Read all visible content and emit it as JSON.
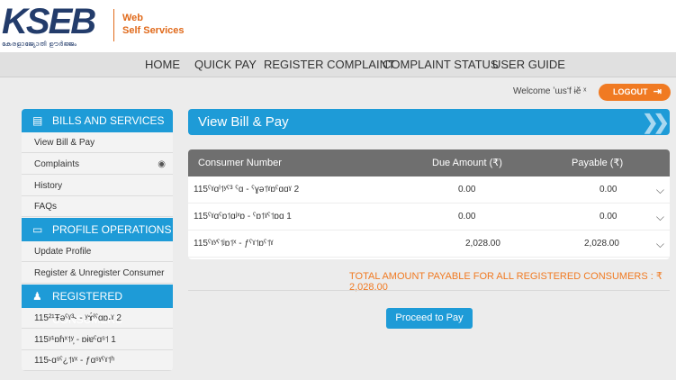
{
  "brand": {
    "logo_text": "KSEB",
    "logo_tagline": "കേരളാജ്യോതി ഊർജ്ജം",
    "site_line1": "Web",
    "site_line2": "Self Services"
  },
  "nav": {
    "items": [
      "HOME",
      "QUICK PAY",
      "REGISTER COMPLAINT",
      "COMPLAINT STATUS",
      "USER GUIDE"
    ]
  },
  "user": {
    "welcome": "Welcome ʼɯsʻf ɨӗ ˣ",
    "logout_label": "LOGOUT"
  },
  "sidebar": {
    "sections": [
      {
        "title": "BILLS AND SERVICES",
        "icon": "document-icon",
        "items": [
          "View Bill & Pay",
          "Complaints",
          "History",
          "FAQs"
        ]
      },
      {
        "title": "PROFILE OPERATIONS",
        "icon": "id-card-icon",
        "items": [
          "Update Profile",
          "Register & Unregister Consumer"
        ]
      },
      {
        "title": "REGISTERED CONSUMERS",
        "icon": "users-icon",
        "items": [
          "115²¹Ŧəˤˠ³˞ - ʸɤ́ˡˤɑɒ˖ˠ 2",
          "115ʸ¹ɒɦˣ˦ʸ̦ - ɒɨɐˤɑˢ˦ 1",
          "115˞ɑˢˤ¿˦ˠˣ - ƒɑˢˠˤˠ˦ʰ"
        ]
      }
    ]
  },
  "main": {
    "title": "View Bill & Pay",
    "columns": [
      "Consumer Number",
      "Due Amount (₹)",
      "Payable (₹)"
    ],
    "rows": [
      {
        "consumer": "115ˤˠɑˡ˦ʸˤ³ ˤɑ - ˤɣə˦ˠɒˤɑɑˠ 2",
        "due": "0.00",
        "payable": "0.00"
      },
      {
        "consumer": "115ˤˠɑˤɒ˦ɑʲˣɒ - ˤɒ˦ˠˤ˦ɒɑ 1",
        "due": "0.00",
        "payable": "0.00"
      },
      {
        "consumer": "115ˤˠʸˤ˦ʲɒ˦ˣ - ƒˤˠ˦ɒˤ˦ˠ",
        "due": "2,028.00",
        "payable": "2,028.00"
      }
    ],
    "total_label": "TOTAL AMOUNT PAYABLE FOR ALL REGISTERED CONSUMERS : ₹  2,028.00",
    "proceed_label": "Proceed to Pay"
  },
  "colors": {
    "accent_blue": "#1e9bd7",
    "accent_orange": "#f07a22",
    "header_gray": "#6f6f6f"
  }
}
